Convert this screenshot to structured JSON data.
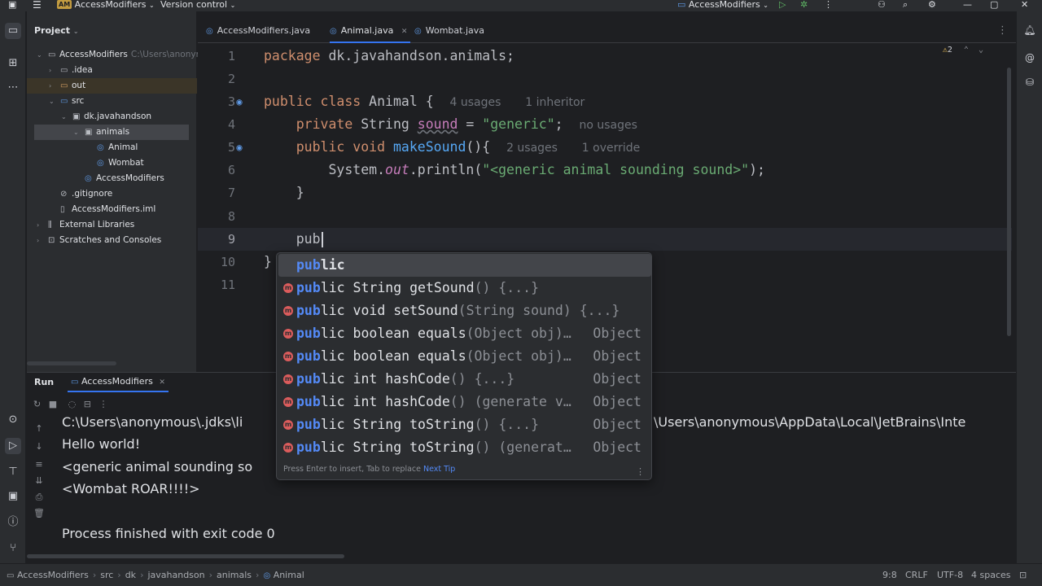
{
  "titlebar": {
    "project_badge": "AM",
    "project_name": "AccessModifiers",
    "vcs": "Version control",
    "run_config": "AccessModifiers"
  },
  "project_panel": {
    "title": "Project",
    "tree": [
      {
        "label": "AccessModifiers",
        "sub": "C:\\Users\\anonymous",
        "icon": "folder-icon"
      },
      {
        "label": ".idea",
        "icon": "folder-icon"
      },
      {
        "label": "out",
        "icon": "folder-icon"
      },
      {
        "label": "src",
        "icon": "folder-icon"
      },
      {
        "label": "dk.javahandson",
        "icon": "package-icon"
      },
      {
        "label": "animals",
        "icon": "package-icon"
      },
      {
        "label": "Animal",
        "icon": "class-icon"
      },
      {
        "label": "Wombat",
        "icon": "class-icon"
      },
      {
        "label": "AccessModifiers",
        "icon": "class-icon"
      },
      {
        "label": ".gitignore",
        "icon": "gitignore-icon"
      },
      {
        "label": "AccessModifiers.iml",
        "icon": "file-icon"
      },
      {
        "label": "External Libraries",
        "icon": "library-icon"
      },
      {
        "label": "Scratches and Consoles",
        "icon": "scratch-icon"
      }
    ]
  },
  "tabs": [
    {
      "label": "AccessModifiers.java"
    },
    {
      "label": "Animal.java"
    },
    {
      "label": "Wombat.java"
    }
  ],
  "editor": {
    "warnings": "2",
    "line_numbers": [
      "1",
      "2",
      "3",
      "4",
      "5",
      "6",
      "7",
      "8",
      "9",
      "10",
      "11"
    ],
    "lines": {
      "l1_pkg": "package",
      "l1_rest": " dk.javahandson.animals;",
      "l3_kw": "public class",
      "l3_rest": " Animal {",
      "l3_hint1": "4 usages",
      "l3_hint2": "1 inheritor",
      "l4_kw": "private",
      "l4_type": " String ",
      "l4_field": "sound",
      "l4_eq": " = ",
      "l4_str": "\"generic\"",
      "l4_end": ";",
      "l4_hint": "no usages",
      "l5_kw": "public void",
      "l5_fn": "makeSound",
      "l5_end": "(){",
      "l5_hint1": "2 usages",
      "l5_hint2": "1 override",
      "l6_pre": "System.",
      "l6_out": "out",
      "l6_mid": ".println(",
      "l6_str": "\"<generic animal sounding sound>\"",
      "l6_end": ");",
      "l7": "}",
      "l9": "pub",
      "l10": "}"
    }
  },
  "completion": {
    "items": [
      {
        "match": "pub",
        "rest": "lic",
        "tail": "",
        "type": ""
      },
      {
        "match": "pub",
        "rest": "lic String getSound",
        "tail": "() {...}",
        "type": ""
      },
      {
        "match": "pub",
        "rest": "lic void setSound",
        "tail": "(String sound) {...}",
        "type": ""
      },
      {
        "match": "pub",
        "rest": "lic boolean equals",
        "tail": "(Object obj)…",
        "type": "Object"
      },
      {
        "match": "pub",
        "rest": "lic boolean equals",
        "tail": "(Object obj)…",
        "type": "Object"
      },
      {
        "match": "pub",
        "rest": "lic int hashCode",
        "tail": "() {...}",
        "type": "Object"
      },
      {
        "match": "pub",
        "rest": "lic int hashCode",
        "tail": "() (generate v…",
        "type": "Object"
      },
      {
        "match": "pub",
        "rest": "lic String toString",
        "tail": "() {...}",
        "type": "Object"
      },
      {
        "match": "pub",
        "rest": "lic String toString",
        "tail": "() (generat…",
        "type": "Object"
      }
    ],
    "footer": "Press Enter to insert, Tab to replace",
    "footer_link": "Next Tip"
  },
  "run_panel": {
    "title": "Run",
    "tab": "AccessModifiers",
    "console": [
      "C:\\Users\\anonymous\\.jdks\\li",
      "Hello world!",
      "<generic animal sounding so",
      "<Wombat ROAR!!!!>",
      "",
      "Process finished with exit code 0"
    ],
    "console_right": "\\Users\\anonymous\\AppData\\Local\\JetBrains\\Inte"
  },
  "statusbar": {
    "breadcrumbs": [
      "AccessModifiers",
      "src",
      "dk",
      "javahandson",
      "animals",
      "Animal"
    ],
    "position": "9:8",
    "line_sep": "CRLF",
    "encoding": "UTF-8",
    "indent": "4 spaces"
  },
  "colors": {
    "background": "#1e1f22",
    "panel": "#2b2d30",
    "accent": "#3574f0",
    "keyword": "#cf8e6d",
    "string": "#6aab73",
    "function": "#56a8f5",
    "field": "#c77dbb"
  }
}
